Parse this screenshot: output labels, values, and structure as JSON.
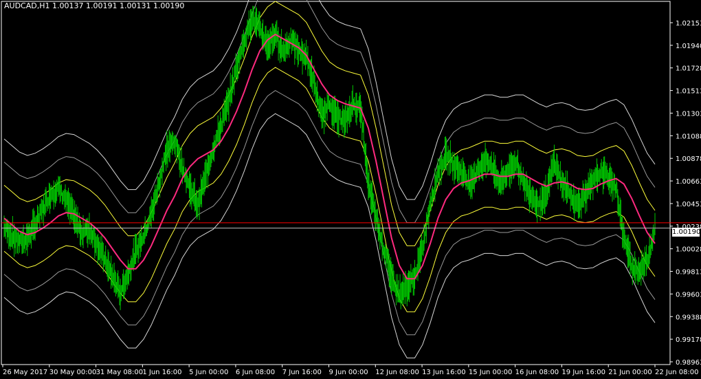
{
  "header": {
    "symbol_label": "AUDCAD,H1  1.00137 1.00191 1.00131 1.00190"
  },
  "price_tag": "1.00190",
  "colors": {
    "background": "#000000",
    "frame": "#ffffff",
    "bars": "#00c800",
    "ma": "#ff2a7f",
    "band_inner": "#ffff3a",
    "band_middle": "#9a9a9a",
    "band_outer": "#d8d8d8",
    "hline_red": "#ff0000",
    "hline_white": "#c0c0c0"
  },
  "chart_data": {
    "type": "line",
    "title": "AUDCAD,H1",
    "xlabel": "",
    "ylabel": "",
    "ylim": [
      0.9895,
      1.0225
    ],
    "y_ticks": [
      "1.02153",
      "1.01940",
      "1.01728",
      "1.01513",
      "1.01303",
      "1.01088",
      "1.00878",
      "1.00663",
      "1.00453",
      "1.00238",
      "1.00028",
      "0.99813",
      "0.99603",
      "0.99388",
      "0.99178",
      "0.98963"
    ],
    "x_tick_labels": [
      "26 May 2017",
      "30 May 00:00",
      "31 May 08:00",
      "1 Jun 16:00",
      "5 Jun 00:00",
      "6 Jun 08:00",
      "7 Jun 16:00",
      "9 Jun 00:00",
      "12 Jun 08:00",
      "13 Jun 16:00",
      "15 Jun 00:00",
      "16 Jun 08:00",
      "19 Jun 16:00",
      "21 Jun 00:00",
      "22 Jun 08:00"
    ],
    "horizontal_lines": [
      {
        "value": 1.00238,
        "color": "#ff0000"
      },
      {
        "value": 1.0019,
        "color": "#c0c0c0"
      }
    ],
    "series": [
      {
        "kind": "price",
        "values": [
          1.002,
          1.0012,
          1.0006,
          1.001,
          1.0022,
          1.0036,
          1.005,
          1.0055,
          1.0044,
          1.003,
          1.0015,
          1.0018,
          1.0005,
          0.999,
          0.9975,
          0.996,
          0.9978,
          0.9998,
          1.0012,
          1.0032,
          1.006,
          1.009,
          1.0098,
          1.0075,
          1.0055,
          1.004,
          1.0066,
          1.0092,
          1.0112,
          1.0135,
          1.0165,
          1.019,
          1.021,
          1.02,
          1.0185,
          1.0195,
          1.018,
          1.019,
          1.018,
          1.0175,
          1.015,
          1.012,
          1.0132,
          1.012,
          1.0115,
          1.0132,
          1.0128,
          1.006,
          1.003,
          1.0,
          0.9975,
          0.996,
          0.9965,
          0.9975,
          1.0,
          1.004,
          1.007,
          1.0085,
          1.0078,
          1.007,
          1.006,
          1.007,
          1.008,
          1.0075,
          1.006,
          1.007,
          1.008,
          1.006,
          1.005,
          1.004,
          1.005,
          1.008,
          1.006,
          1.005,
          1.004,
          1.005,
          1.006,
          1.007,
          1.0065,
          1.0055,
          1.001,
          0.9985,
          0.998,
          0.999,
          1.0019
        ]
      },
      {
        "name": "",
        "kind": "ma",
        "values": [
          1.0028,
          1.0022,
          1.0016,
          1.0013,
          1.0015,
          1.0019,
          1.0024,
          1.003,
          1.0033,
          1.0032,
          1.0028,
          1.0024,
          1.0018,
          1.001,
          1.0,
          0.999,
          0.9982,
          0.9982,
          0.999,
          1.0003,
          1.0019,
          1.0035,
          1.0048,
          1.0064,
          1.0075,
          1.0082,
          1.0086,
          1.009,
          1.0098,
          1.011,
          1.0125,
          1.0143,
          1.0163,
          1.018,
          1.019,
          1.0195,
          1.0191,
          1.0187,
          1.0183,
          1.0176,
          1.0163,
          1.015,
          1.014,
          1.0135,
          1.0132,
          1.013,
          1.0128,
          1.011,
          1.008,
          1.0045,
          1.001,
          0.9985,
          0.9973,
          0.9973,
          0.9985,
          1.0005,
          1.0028,
          1.0045,
          1.0055,
          1.006,
          1.0062,
          1.0065,
          1.0068,
          1.0068,
          1.0066,
          1.0066,
          1.0068,
          1.0068,
          1.0064,
          1.006,
          1.0057,
          1.006,
          1.0061,
          1.0059,
          1.0055,
          1.0054,
          1.0055,
          1.0059,
          1.0062,
          1.0064,
          1.0059,
          1.0046,
          1.003,
          1.0015,
          1.0005
        ]
      },
      {
        "name": "",
        "kind": "band_inner",
        "offset": 0.003
      },
      {
        "name": "",
        "kind": "band_middle",
        "offset": 0.0051
      },
      {
        "name": "",
        "kind": "band_outer",
        "offset": 0.0072
      }
    ]
  }
}
